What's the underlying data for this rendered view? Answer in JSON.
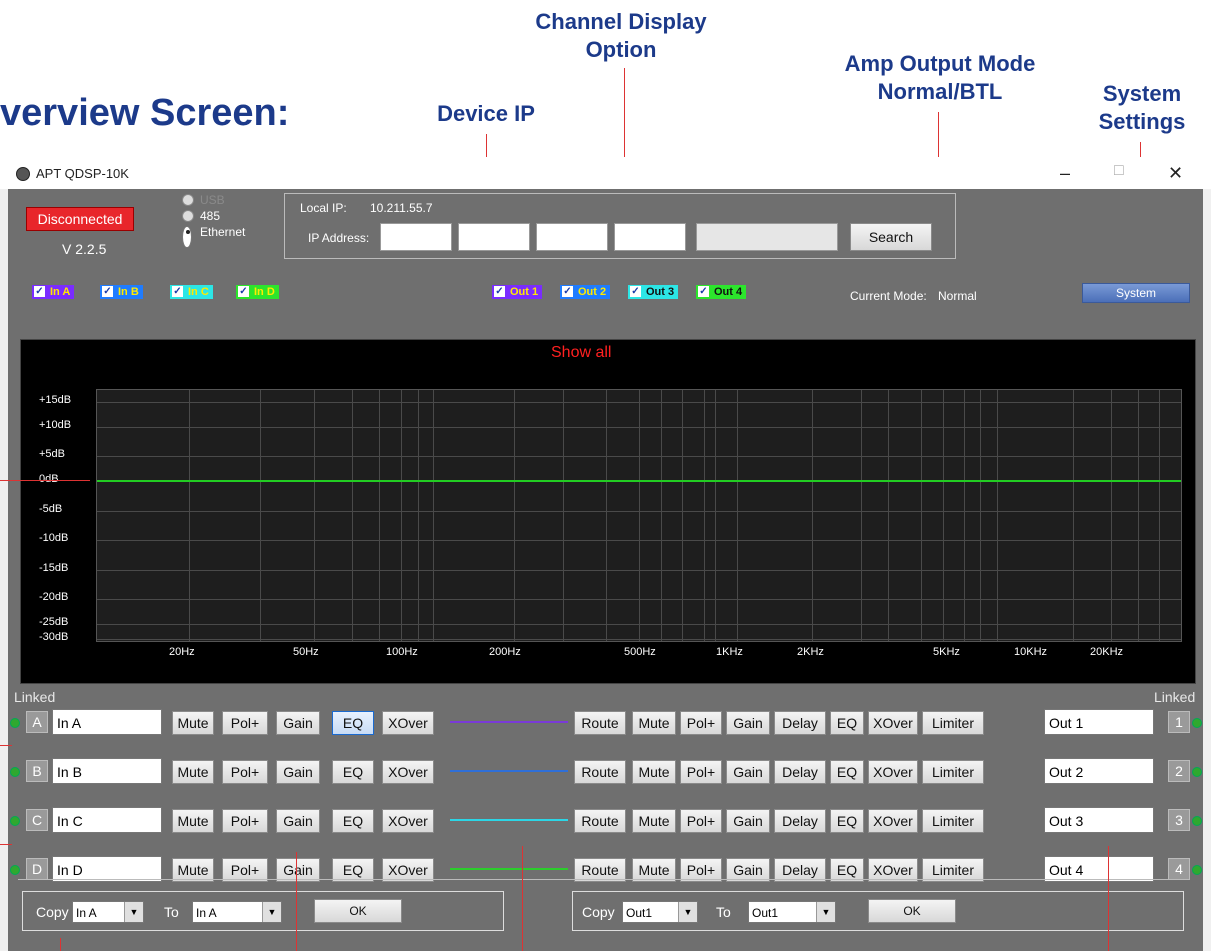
{
  "callouts": {
    "heading": "verview Screen:",
    "device_ip": "Device IP",
    "channel_display": "Channel Display Option",
    "amp_output": "Amp Output Mode Normal/BTL",
    "system_settings": "System Settings"
  },
  "window": {
    "title": "APT QDSP-10K",
    "minimize": "–",
    "maximize": "□",
    "close": "✕"
  },
  "status": {
    "connection": "Disconnected",
    "version": "V 2.2.5",
    "interface_options": [
      "USB",
      "485",
      "Ethernet"
    ],
    "selected_interface": "Ethernet",
    "local_ip_label": "Local IP:",
    "local_ip": "10.211.55.7",
    "ip_address_label": "IP Address:",
    "search_label": "Search",
    "current_mode_label": "Current Mode:",
    "current_mode": "Normal",
    "system_label": "System"
  },
  "channels": {
    "inputs": [
      {
        "label": "In A",
        "color": "#7a2cff",
        "text": "#ffea00"
      },
      {
        "label": "In B",
        "color": "#1f7cff",
        "text": "#ffea00"
      },
      {
        "label": "In C",
        "color": "#2ce6e6",
        "text": "#ffea00"
      },
      {
        "label": "In D",
        "color": "#2ce62c",
        "text": "#ffea00"
      }
    ],
    "outputs": [
      {
        "label": "Out 1",
        "color": "#7a2cff",
        "text": "#ffea00"
      },
      {
        "label": "Out 2",
        "color": "#1f7cff",
        "text": "#ffea00"
      },
      {
        "label": "Out 3",
        "color": "#2ce6e6",
        "text": "#111111"
      },
      {
        "label": "Out 4",
        "color": "#2ce62c",
        "text": "#111111"
      }
    ]
  },
  "graph": {
    "show_label": "Show all",
    "y_ticks": [
      "+15dB",
      "+10dB",
      "+5dB",
      "0dB",
      "-5dB",
      "-10dB",
      "-15dB",
      "-20dB",
      "-25dB",
      "-30dB"
    ],
    "x_ticks": [
      "20Hz",
      "50Hz",
      "100Hz",
      "200Hz",
      "500Hz",
      "1KHz",
      "2KHz",
      "5KHz",
      "10KHz",
      "20KHz"
    ],
    "curve_color": "#22cc22"
  },
  "rows": {
    "linked_label": "Linked",
    "input_buttons": [
      "Mute",
      "Pol+",
      "Gain",
      "EQ",
      "XOver"
    ],
    "output_buttons": [
      "Route",
      "Mute",
      "Pol+",
      "Gain",
      "Delay",
      "EQ",
      "XOver",
      "Limiter"
    ],
    "items": [
      {
        "letter": "A",
        "in_name": "In A",
        "out_name": "Out 1",
        "num": "1",
        "line_color": "#7a3ad8"
      },
      {
        "letter": "B",
        "in_name": "In B",
        "out_name": "Out 2",
        "num": "2",
        "line_color": "#2f6fd8"
      },
      {
        "letter": "C",
        "in_name": "In C",
        "out_name": "Out 3",
        "num": "3",
        "line_color": "#2cd6e6"
      },
      {
        "letter": "D",
        "in_name": "In D",
        "out_name": "Out 4",
        "num": "4",
        "line_color": "#2ccc2c"
      }
    ]
  },
  "copy": {
    "copy_label": "Copy",
    "to_label": "To",
    "ok_label": "OK",
    "in_from": "In A",
    "in_to": "In A",
    "out_from": "Out1",
    "out_to": "Out1",
    "arrow": "▼"
  }
}
